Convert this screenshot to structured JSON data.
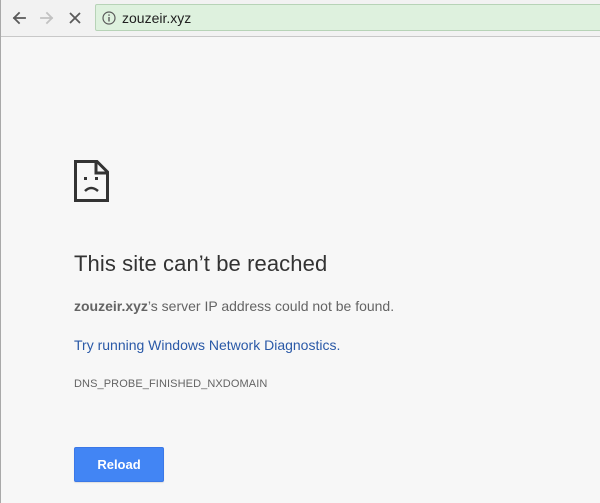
{
  "toolbar": {
    "url": "zouzeir.xyz",
    "icons": {
      "back": "back-arrow-icon",
      "forward": "forward-arrow-icon",
      "stop": "stop-x-icon",
      "info": "info-icon"
    }
  },
  "error_page": {
    "icon": "sad-page-icon",
    "title": "This site can’t be reached",
    "summary_host": "zouzeir.xyz",
    "summary_rest": "’s server IP address could not be found.",
    "diagnostics_link": "Try running Windows Network Diagnostics.",
    "error_code": "DNS_PROBE_FINISHED_NXDOMAIN",
    "reload_label": "Reload"
  },
  "colors": {
    "omnibox_bg": "#def1de",
    "link": "#2a59a7",
    "button": "#4285f4",
    "page_bg": "#f7f7f7"
  }
}
